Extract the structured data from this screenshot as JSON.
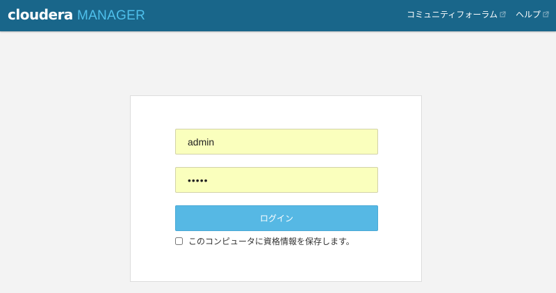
{
  "header": {
    "brand_main": "cloudera",
    "brand_sub": "MANAGER",
    "links": [
      {
        "label": "コミュニティフォーラム",
        "icon": "external-link-icon"
      },
      {
        "label": "ヘルプ",
        "icon": "external-link-icon"
      }
    ]
  },
  "login": {
    "username_value": "admin",
    "password_value": "•••••",
    "submit_label": "ログイン",
    "remember_label": "このコンピュータに資格情報を保存します。",
    "remember_checked": false
  },
  "colors": {
    "header_bg": "#19668a",
    "brand_sub": "#4fc0ec",
    "button_bg": "#56b8e4",
    "autofill_bg": "#faffbd",
    "page_bg": "#f3f3f3"
  }
}
